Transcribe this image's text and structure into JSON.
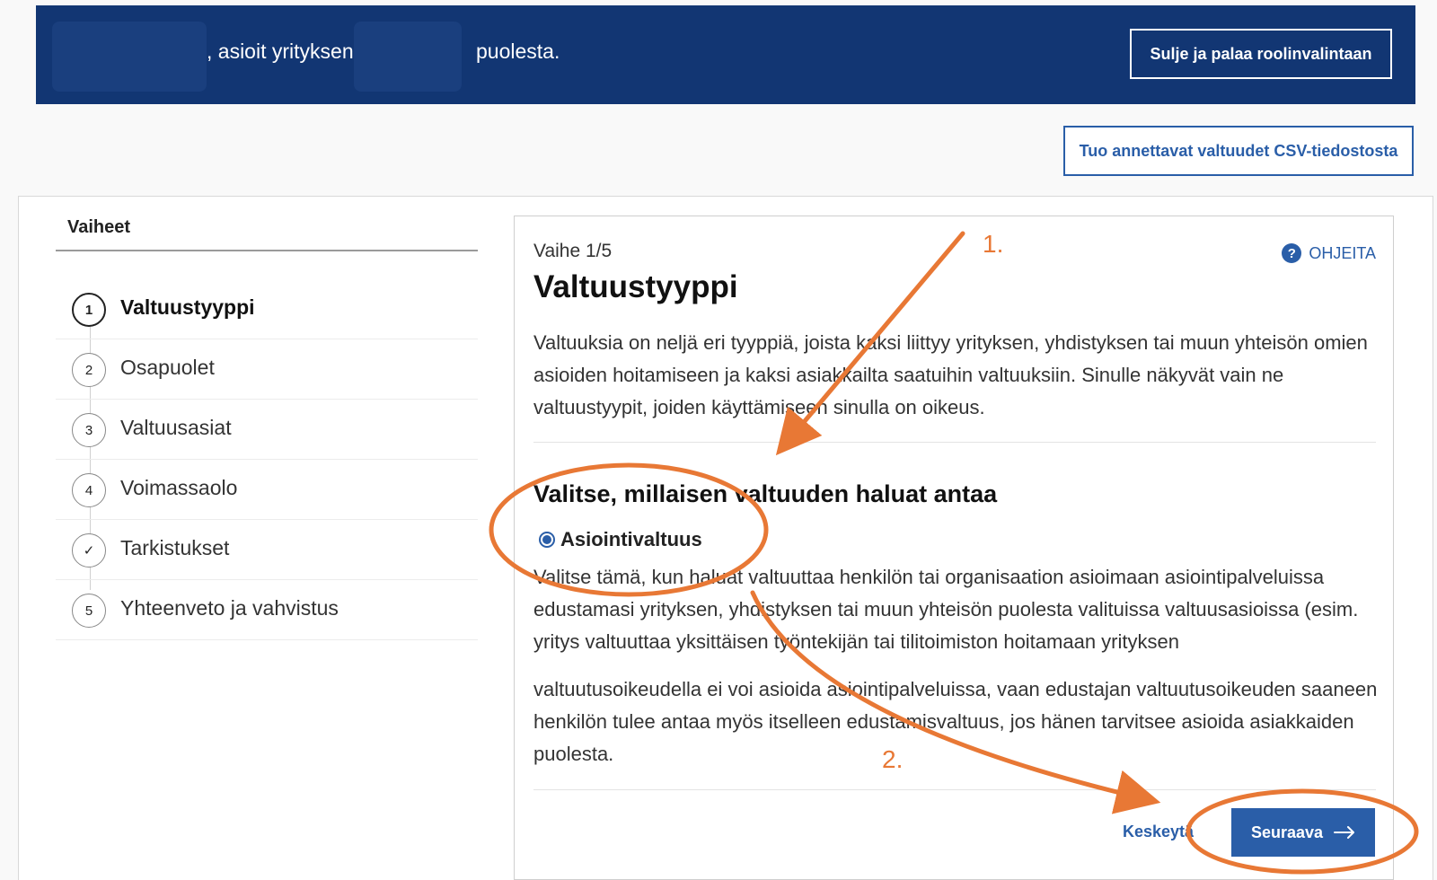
{
  "banner": {
    "text_middle": ", asioit yrityksen",
    "text_end": "puolesta.",
    "close_button": "Sulje ja palaa roolinvalintaan"
  },
  "csv_button": "Tuo annettavat valtuudet CSV-tiedostosta",
  "steps": {
    "title": "Vaiheet",
    "items": [
      {
        "marker": "1",
        "label": "Valtuustyyppi",
        "active": true
      },
      {
        "marker": "2",
        "label": "Osapuolet"
      },
      {
        "marker": "3",
        "label": "Valtuusasiat"
      },
      {
        "marker": "4",
        "label": "Voimassaolo"
      },
      {
        "marker": "✓",
        "label": "Tarkistukset"
      },
      {
        "marker": "5",
        "label": "Yhteenveto ja vahvistus"
      }
    ]
  },
  "content": {
    "phase": "Vaihe 1/5",
    "title": "Valtuustyyppi",
    "help_label": "OHJEITA",
    "help_icon": "question-icon",
    "intro": "Valtuuksia on neljä eri tyyppiä, joista kaksi liittyy yrityksen, yhdistyksen tai muun yhteisön omien asioiden hoitamiseen ja kaksi asiakkailta saatuihin valtuuksiin. Sinulle näkyvät vain ne valtuustyypit, joiden käyttämiseen sinulla on oikeus.",
    "section_heading": "Valitse, millaisen valtuuden haluat antaa",
    "option_label": "Asiointivaltuus",
    "option_desc_top": "Valitse tämä, kun haluat valtuuttaa henkilön tai organisaation asioimaan asiointipalveluissa edustamasi yrityksen, yhdistyksen tai muun yhteisön puolesta valituissa valtuusasioissa (esim. yritys valtuuttaa yksittäisen työntekijän tai tilitoimiston hoitamaan yrityksen",
    "option_desc_bottom": "valtuutusoikeudella ei voi asioida asiointipalveluissa, vaan edustajan valtuutusoikeuden saaneen henkilön tulee antaa myös itselleen edustamisvaltuus, jos hänen tarvitsee asioida asiakkaiden puolesta.",
    "cancel_label": "Keskeytä",
    "next_label": "Seuraava",
    "next_icon": "arrow-right-icon"
  },
  "annotations": {
    "label_1": "1.",
    "label_2": "2.",
    "color": "#e87835"
  },
  "colors": {
    "banner": "#123673",
    "primary": "#2a5ea8"
  }
}
